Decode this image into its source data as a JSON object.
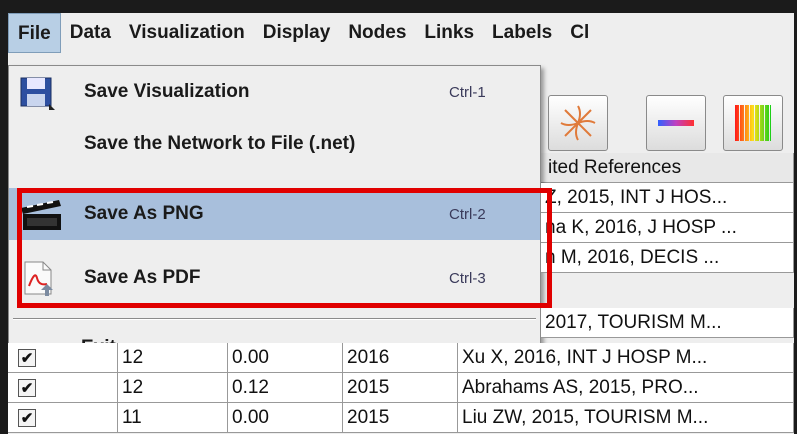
{
  "menubar": [
    "File",
    "Data",
    "Visualization",
    "Display",
    "Nodes",
    "Links",
    "Labels",
    "Cl"
  ],
  "file_menu": {
    "save_visualization": {
      "label": "Save Visualization",
      "shortcut": "Ctrl-1"
    },
    "save_network": {
      "label": "Save the Network to File (.net)"
    },
    "save_png": {
      "label": "Save As PNG",
      "shortcut": "Ctrl-2"
    },
    "save_pdf": {
      "label": "Save As PDF",
      "shortcut": "Ctrl-3"
    },
    "exit": {
      "label": "Exit"
    }
  },
  "table": {
    "header_visible": "ited References",
    "rows": [
      {
        "col4": "Z, 2015, INT J HOS..."
      },
      {
        "col4": "na K, 2016, J HOSP ..."
      },
      {
        "col4": "n M, 2016, DECIS ..."
      },
      {
        "col4": "2017, TOURISM M..."
      },
      {
        "checked": "✔",
        "c1": "12",
        "c2": "0.00",
        "c3": "2016",
        "col4": "Xu X, 2016, INT J HOSP M..."
      },
      {
        "checked": "✔",
        "c1": "12",
        "c2": "0.12",
        "c3": "2015",
        "col4": "Abrahams AS, 2015, PRO..."
      },
      {
        "checked": "✔",
        "c1": "11",
        "c2": "0.00",
        "c3": "2015",
        "col4": "Liu ZW, 2015, TOURISM M..."
      }
    ]
  },
  "colors": {
    "highlight": "#a8bfdc",
    "annotation_box": "#e00000",
    "active_menu": "#b8cfe5"
  }
}
